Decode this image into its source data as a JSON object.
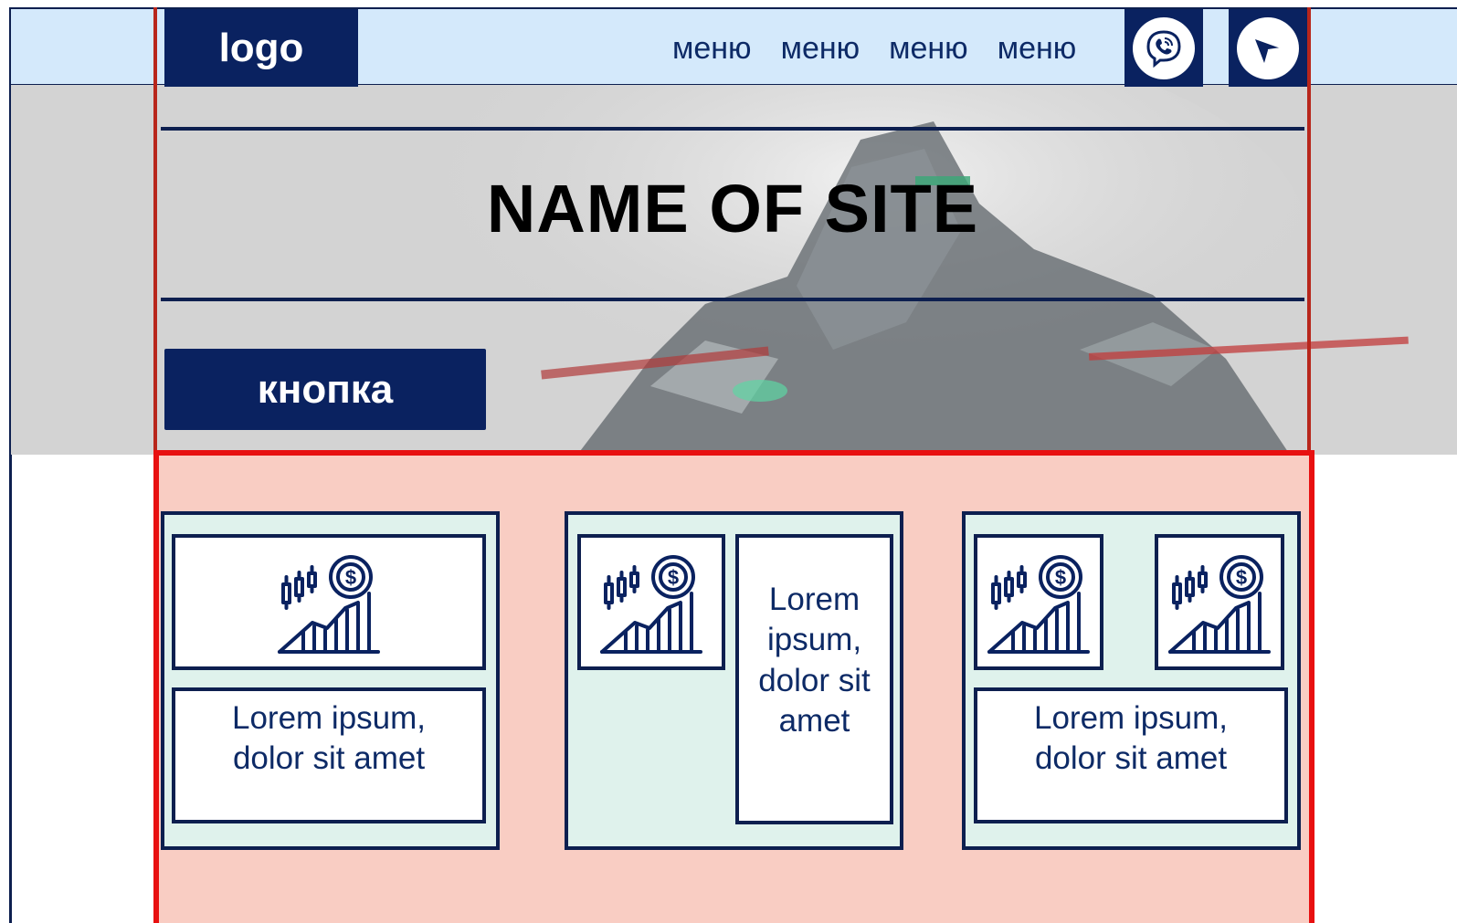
{
  "header": {
    "logo": "logo",
    "menu": [
      "меню",
      "меню",
      "меню",
      "меню"
    ],
    "icons": [
      "viber-icon",
      "telegram-icon"
    ]
  },
  "hero": {
    "title": "NAME OF SITE",
    "button_label": "кнопка"
  },
  "cards": [
    {
      "text": "Lorem ipsum,\ndolor sit amet"
    },
    {
      "text": "Lorem\nipsum,\ndolor sit\namet"
    },
    {
      "text": "Lorem ipsum,\ndolor sit amet"
    }
  ],
  "colors": {
    "navy": "#0a2260",
    "header_bg": "#d4e9fb",
    "hero_bg": "#d3d3d3",
    "section_bg": "#f9cdc3",
    "section_border": "#e81010",
    "card_bg": "#dff2ec"
  }
}
